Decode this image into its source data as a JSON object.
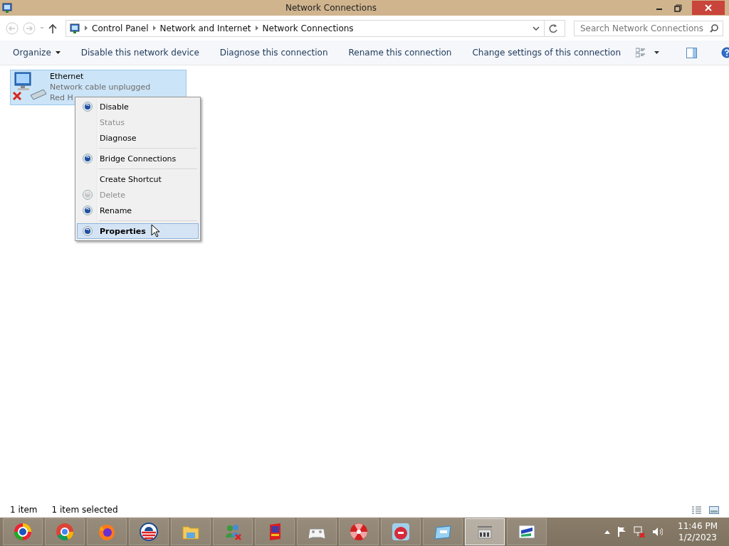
{
  "window": {
    "title": "Network Connections"
  },
  "address_bar": {
    "path": [
      "Control Panel",
      "Network and Internet",
      "Network Connections"
    ]
  },
  "search": {
    "placeholder": "Search Network Connections"
  },
  "command_bar": {
    "items": [
      "Organize",
      "Disable this network device",
      "Diagnose this connection",
      "Rename this connection",
      "Change settings of this connection"
    ]
  },
  "connections": [
    {
      "name": "Ethernet",
      "status": "Network cable unplugged",
      "device": "Red H",
      "selected": true,
      "disconnected": true
    }
  ],
  "context_menu": {
    "items": [
      {
        "kind": "item",
        "label": "Disable",
        "icon": true,
        "disabled": false,
        "default": false,
        "selected": false
      },
      {
        "kind": "item",
        "label": "Status",
        "icon": false,
        "disabled": true,
        "default": false,
        "selected": false
      },
      {
        "kind": "item",
        "label": "Diagnose",
        "icon": false,
        "disabled": false,
        "default": false,
        "selected": false
      },
      {
        "kind": "separator"
      },
      {
        "kind": "item",
        "label": "Bridge Connections",
        "icon": true,
        "disabled": false,
        "default": false,
        "selected": false
      },
      {
        "kind": "separator"
      },
      {
        "kind": "item",
        "label": "Create Shortcut",
        "icon": false,
        "disabled": false,
        "default": false,
        "selected": false
      },
      {
        "kind": "item",
        "label": "Delete",
        "icon": true,
        "disabled": true,
        "default": false,
        "selected": false
      },
      {
        "kind": "item",
        "label": "Rename",
        "icon": true,
        "disabled": false,
        "default": false,
        "selected": false
      },
      {
        "kind": "separator"
      },
      {
        "kind": "item",
        "label": "Properties",
        "icon": true,
        "disabled": false,
        "default": true,
        "selected": true
      }
    ]
  },
  "status_bar": {
    "count": "1 item",
    "selection": "1 item selected"
  },
  "taskbar": {
    "apps": [
      {
        "kind": "ring",
        "active": false
      },
      {
        "kind": "chrome",
        "active": false
      },
      {
        "kind": "fox",
        "active": false
      },
      {
        "kind": "logo",
        "active": false
      },
      {
        "kind": "folder",
        "active": false
      },
      {
        "kind": "people",
        "active": false
      },
      {
        "kind": "book",
        "active": false
      },
      {
        "kind": "gamepad",
        "active": false
      },
      {
        "kind": "radiation",
        "active": false
      },
      {
        "kind": "bird",
        "active": false
      },
      {
        "kind": "panel",
        "active": false
      },
      {
        "kind": "control",
        "active": true
      },
      {
        "kind": "network",
        "active": false
      }
    ],
    "time": "11:46 PM",
    "date": "1/2/2023"
  }
}
